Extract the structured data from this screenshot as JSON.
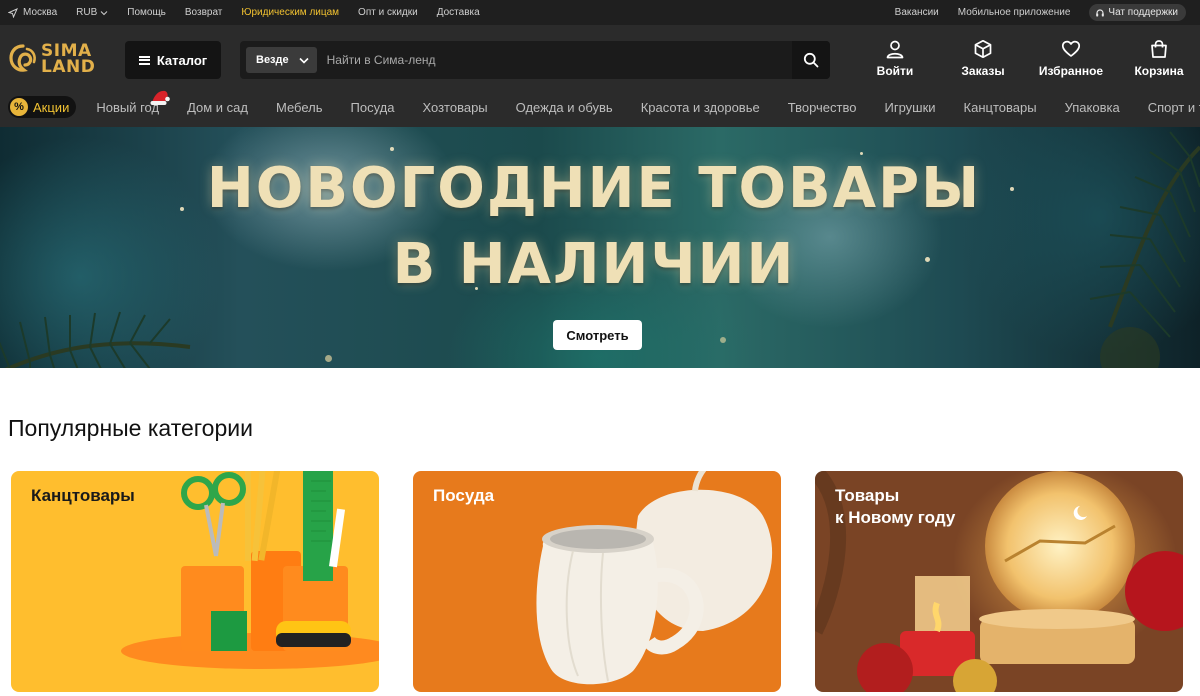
{
  "topbar": {
    "city": "Москва",
    "currency": "RUB",
    "links": [
      "Помощь",
      "Возврат",
      "Юридическим лицам",
      "Опт и скидки",
      "Доставка"
    ],
    "right_links": [
      "Вакансии",
      "Мобильное приложение"
    ],
    "support_chat": "Чат поддержки"
  },
  "header": {
    "logo_line1": "SIMA",
    "logo_line2": "LAND",
    "catalog_label": "Каталог",
    "search_scope": "Везде",
    "search_placeholder": "Найти в Сима-ленд",
    "actions": [
      "Войти",
      "Заказы",
      "Избранное",
      "Корзина"
    ]
  },
  "nav": {
    "promo_label": "Акции",
    "items": [
      "Новый год",
      "Дом и сад",
      "Мебель",
      "Посуда",
      "Хозтовары",
      "Одежда и обувь",
      "Красота и здоровье",
      "Творчество",
      "Игрушки",
      "Канцтовары",
      "Упаковка",
      "Спорт и туризм"
    ]
  },
  "hero": {
    "line1": "НОВОГОДНИЕ ТОВАРЫ",
    "line2": "В НАЛИЧИИ",
    "cta_label": "Смотреть"
  },
  "popular": {
    "title": "Популярные категории",
    "cards": [
      "Канцтовары",
      "Посуда",
      "Товары\nк Новому году"
    ]
  },
  "colors": {
    "accent_gold": "#e2b04a",
    "legal_link": "#f2c230",
    "header_bg": "#2b2b2b",
    "card_stationery": "#ffbe2e",
    "card_dishes": "#e77a1c"
  }
}
